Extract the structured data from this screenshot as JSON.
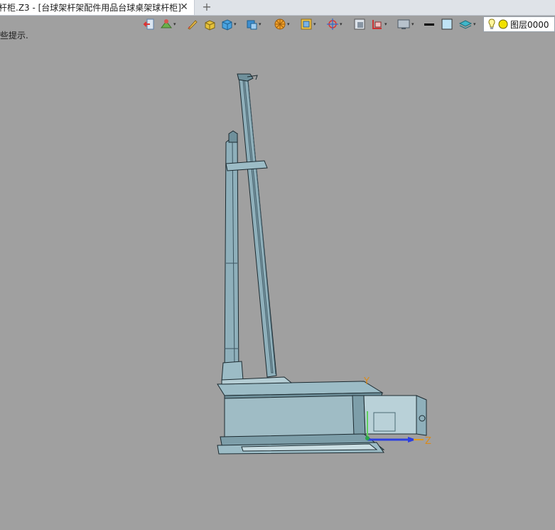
{
  "tab": {
    "title": "杆柜.Z3 - [台球架杆架配件用品台球桌架球杆柜]",
    "close_glyph": "✕",
    "new_glyph": "+"
  },
  "hint": {
    "text": "些提示."
  },
  "toolbar": {
    "icons": [
      "exit-icon",
      "plane-icon",
      "pencil-icon",
      "solid-box-icon",
      "cube-icon",
      "shaded-cube-icon",
      "render-wheel-icon",
      "display-mode-icon",
      "axis-icon",
      "frame-icon",
      "section-icon",
      "monitor-icon",
      "line-color-icon",
      "fill-color-icon",
      "layer-shape-icon"
    ]
  },
  "layer": {
    "label": "图层0000",
    "light_color": "#f2e100"
  },
  "axes": {
    "y_label": "Y",
    "z_label": "Z"
  },
  "colors": {
    "model_fill": "#8fb0bb",
    "model_edge": "#1b2a30",
    "axis_label": "#d98a1a"
  }
}
